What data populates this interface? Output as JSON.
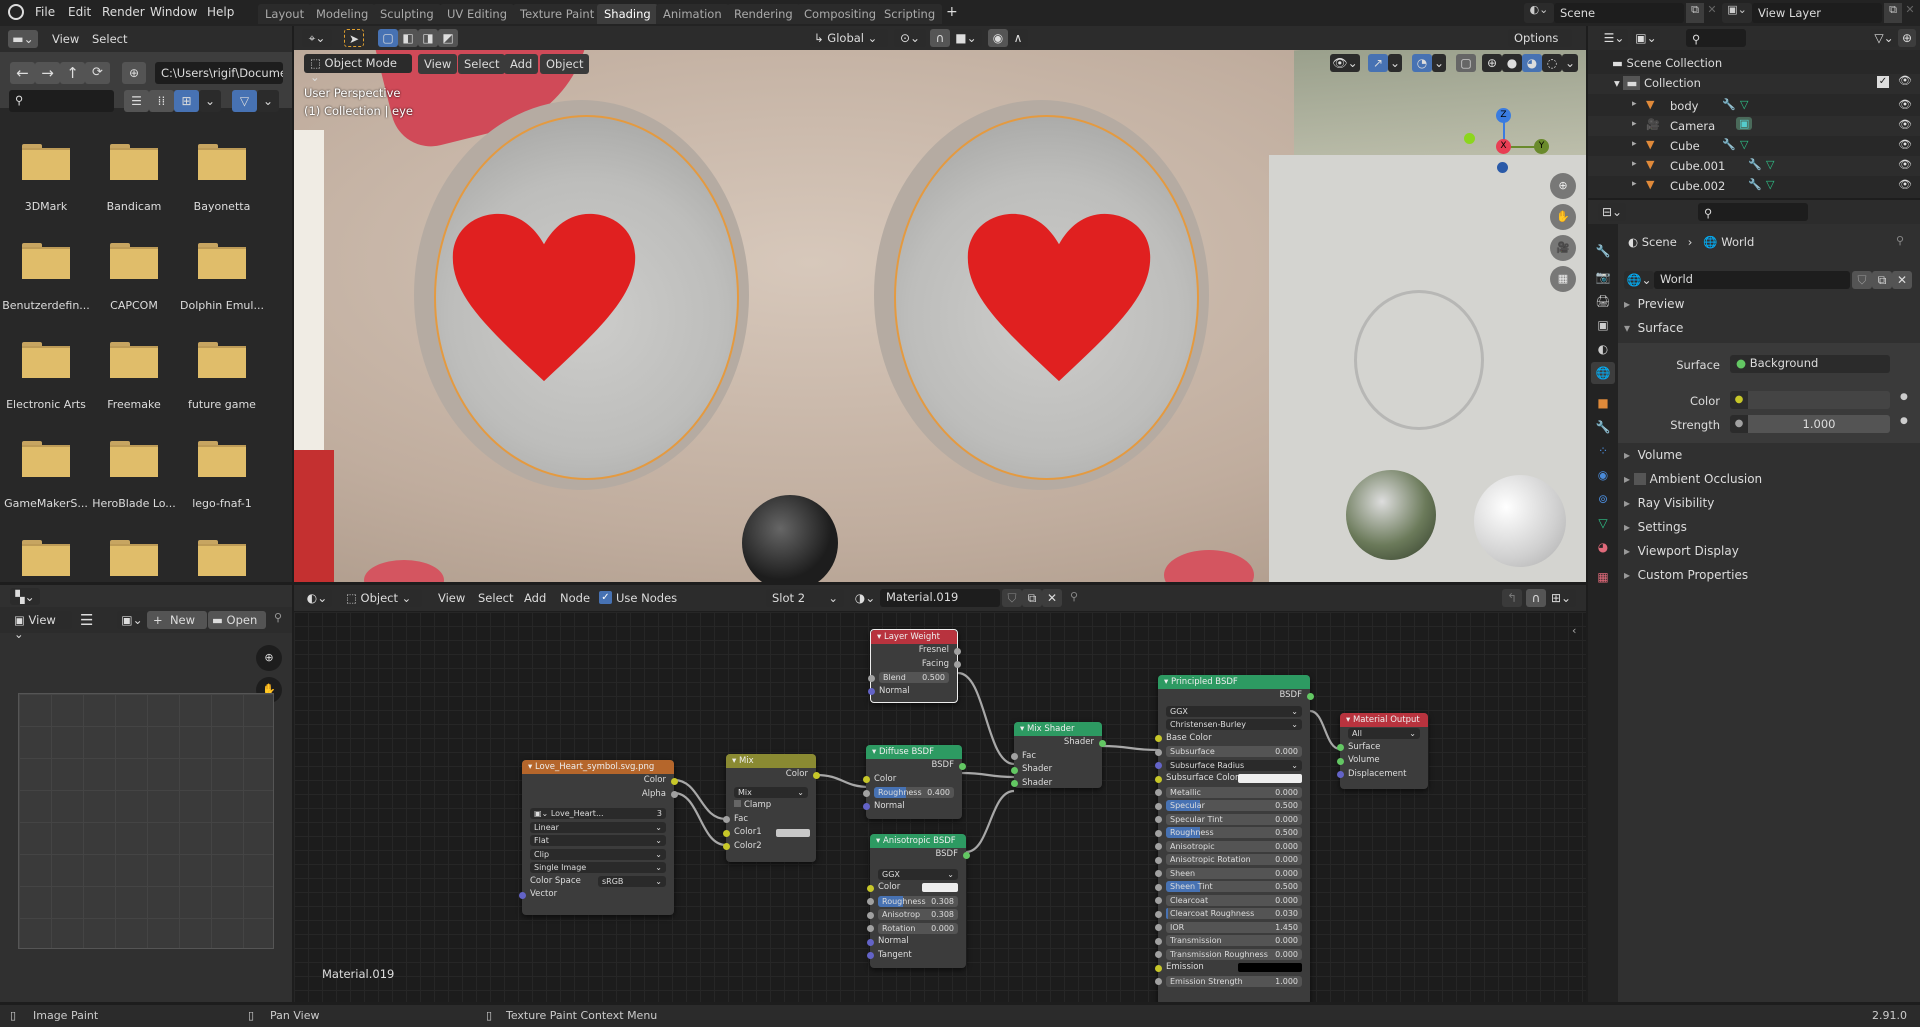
{
  "topbar": {
    "menus": [
      "File",
      "Edit",
      "Render",
      "Window",
      "Help"
    ],
    "workspaces": [
      "Layout",
      "Modeling",
      "Sculpting",
      "UV Editing",
      "Texture Paint",
      "Shading",
      "Animation",
      "Rendering",
      "Compositing",
      "Scripting"
    ],
    "active_workspace": "Shading",
    "add_tab": "+",
    "scene": "Scene",
    "view_layer": "View Layer"
  },
  "file_browser": {
    "menus": [
      "View",
      "Select"
    ],
    "path": "C:\\Users\\rigif\\Docume...",
    "search_placeholder": "",
    "folders": [
      "3DMark",
      "Bandicam",
      "Bayonetta",
      "Benutzerdefin...",
      "CAPCOM",
      "Dolphin Emul...",
      "Electronic Arts",
      "Freemake",
      "future game",
      "GameMakerS...",
      "HeroBlade Lo...",
      "lego-fnaf-1",
      "",
      "",
      ""
    ]
  },
  "image_editor": {
    "view_label": "View",
    "new_label": "New",
    "open_label": "Open"
  },
  "viewport_header": {
    "transform_orientation": "Global",
    "options_label": "Options",
    "mode": "Object Mode",
    "menus": [
      "View",
      "Select",
      "Add",
      "Object"
    ]
  },
  "viewport": {
    "perspective": "User Perspective",
    "collection_info": "(1) Collection | eye",
    "gizmo": {
      "x": "X",
      "y": "Y",
      "z": "Z"
    }
  },
  "node_editor_header": {
    "mode": "Object",
    "menus": [
      "View",
      "Select",
      "Add",
      "Node"
    ],
    "use_nodes_label": "Use Nodes",
    "use_nodes": true,
    "slot": "Slot 2",
    "material": "Material.019"
  },
  "node_editor": {
    "material_label": "Material.019",
    "nodes": {
      "image_texture": {
        "title": "Love_Heart_symbol.svg.png",
        "outputs": [
          "Color",
          "Alpha"
        ],
        "image_name": "Love_Heart...",
        "users": "3",
        "interpolation": "Linear",
        "projection": "Flat",
        "extension": "Clip",
        "source": "Single Image",
        "color_space_label": "Color Space",
        "color_space": "sRGB",
        "inputs": [
          "Vector"
        ]
      },
      "mix": {
        "title": "Mix",
        "output": "Color",
        "blend_type": "Mix",
        "clamp_label": "Clamp",
        "inputs": [
          "Fac",
          "Color1",
          "Color2"
        ]
      },
      "layer_weight": {
        "title": "Layer Weight",
        "outputs": [
          "Fresnel",
          "Facing"
        ],
        "blend_label": "Blend",
        "blend_value": "0.500",
        "normal_label": "Normal"
      },
      "diffuse": {
        "title": "Diffuse BSDF",
        "output": "BSDF",
        "color_label": "Color",
        "roughness_label": "Roughness",
        "roughness": "0.400",
        "normal_label": "Normal"
      },
      "anisotropic": {
        "title": "Anisotropic BSDF",
        "output": "BSDF",
        "distribution": "GGX",
        "color_label": "Color",
        "fields": [
          {
            "label": "Roughness",
            "value": "0.308",
            "fill": 0.308
          },
          {
            "label": "Anisotrop",
            "value": "0.308",
            "fill": 0
          },
          {
            "label": "Rotation",
            "value": "0.000",
            "fill": 0
          }
        ],
        "normal_label": "Normal",
        "tangent_label": "Tangent"
      },
      "mix_shader": {
        "title": "Mix Shader",
        "output": "Shader",
        "inputs": [
          "Fac",
          "Shader",
          "Shader"
        ]
      },
      "principled": {
        "title": "Principled BSDF",
        "output": "BSDF",
        "distribution": "GGX",
        "subsurface_method": "Christensen-Burley",
        "base_color_label": "Base Color",
        "subsurface_label": "Subsurface",
        "subsurface": "0.000",
        "subsurface_radius_label": "Subsurface Radius",
        "subsurface_color_label": "Subsurface Color",
        "fields": [
          {
            "label": "Metallic",
            "value": "0.000",
            "fill": 0
          },
          {
            "label": "Specular",
            "value": "0.500",
            "fill": 0.5
          },
          {
            "label": "Specular Tint",
            "value": "0.000",
            "fill": 0
          },
          {
            "label": "Roughness",
            "value": "0.500",
            "fill": 0.5
          },
          {
            "label": "Anisotropic",
            "value": "0.000",
            "fill": 0
          },
          {
            "label": "Anisotropic Rotation",
            "value": "0.000",
            "fill": 0
          },
          {
            "label": "Sheen",
            "value": "0.000",
            "fill": 0
          },
          {
            "label": "Sheen Tint",
            "value": "0.500",
            "fill": 0.5
          },
          {
            "label": "Clearcoat",
            "value": "0.000",
            "fill": 0
          },
          {
            "label": "Clearcoat Roughness",
            "value": "0.030",
            "fill": 0.03
          },
          {
            "label": "IOR",
            "value": "1.450",
            "fill": 0
          },
          {
            "label": "Transmission",
            "value": "0.000",
            "fill": 0
          },
          {
            "label": "Transmission Roughness",
            "value": "0.000",
            "fill": 0
          }
        ],
        "emission_label": "Emission",
        "emission_strength_label": "Emission Strength",
        "emission_strength": "1.000"
      },
      "material_output": {
        "title": "Material Output",
        "target": "All",
        "inputs": [
          "Surface",
          "Volume",
          "Displacement"
        ]
      }
    }
  },
  "outliner": {
    "scene_collection": "Scene Collection",
    "collection": "Collection",
    "items": [
      "body",
      "Camera",
      "Cube",
      "Cube.001",
      "Cube.002"
    ]
  },
  "properties": {
    "breadcrumb": [
      "Scene",
      "World"
    ],
    "world_name": "World",
    "sections": {
      "preview": "Preview",
      "surface": "Surface",
      "volume": "Volume",
      "ambient_occlusion": "Ambient Occlusion",
      "ray_visibility": "Ray Visibility",
      "settings": "Settings",
      "viewport_display": "Viewport Display",
      "custom_properties": "Custom Properties"
    },
    "surface_label": "Surface",
    "surface_value": "Background",
    "color_label": "Color",
    "strength_label": "Strength",
    "strength_value": "1.000"
  },
  "statusbar": {
    "left_hint": "Image Paint",
    "middle_hint": "Pan View",
    "right_hint": "Texture Paint Context Menu",
    "version": "2.91.0"
  },
  "colors": {
    "accent": "#4772b3",
    "active_tab": "#3d3d3d",
    "folder": "#e0bd6a",
    "heart": "#e02020",
    "texture_header": "#b5662b",
    "mix_header": "#8a8a32",
    "shader_header": "#2d9a62",
    "output_header": "#b8333e"
  }
}
